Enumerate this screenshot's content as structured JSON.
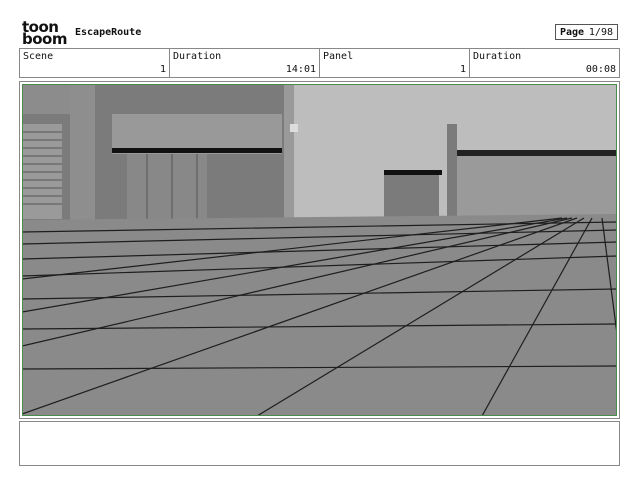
{
  "logo": {
    "line1": "toon",
    "line2": "boom"
  },
  "header": {
    "title": "EscapeRoute",
    "page_label": "Page",
    "page_value": "1/98"
  },
  "info": [
    {
      "key": "Scene",
      "value": "1"
    },
    {
      "key": "Duration",
      "value": "14:01"
    },
    {
      "key": "Panel",
      "value": "1"
    },
    {
      "key": "Duration",
      "value": "00:08"
    }
  ],
  "colors": {
    "frame_border": "#4a8a4a",
    "sky": "#bdbdbd",
    "ground": "#8a8a8a",
    "building": "#7b7b7b",
    "grid_line": "#1e1e1e"
  }
}
